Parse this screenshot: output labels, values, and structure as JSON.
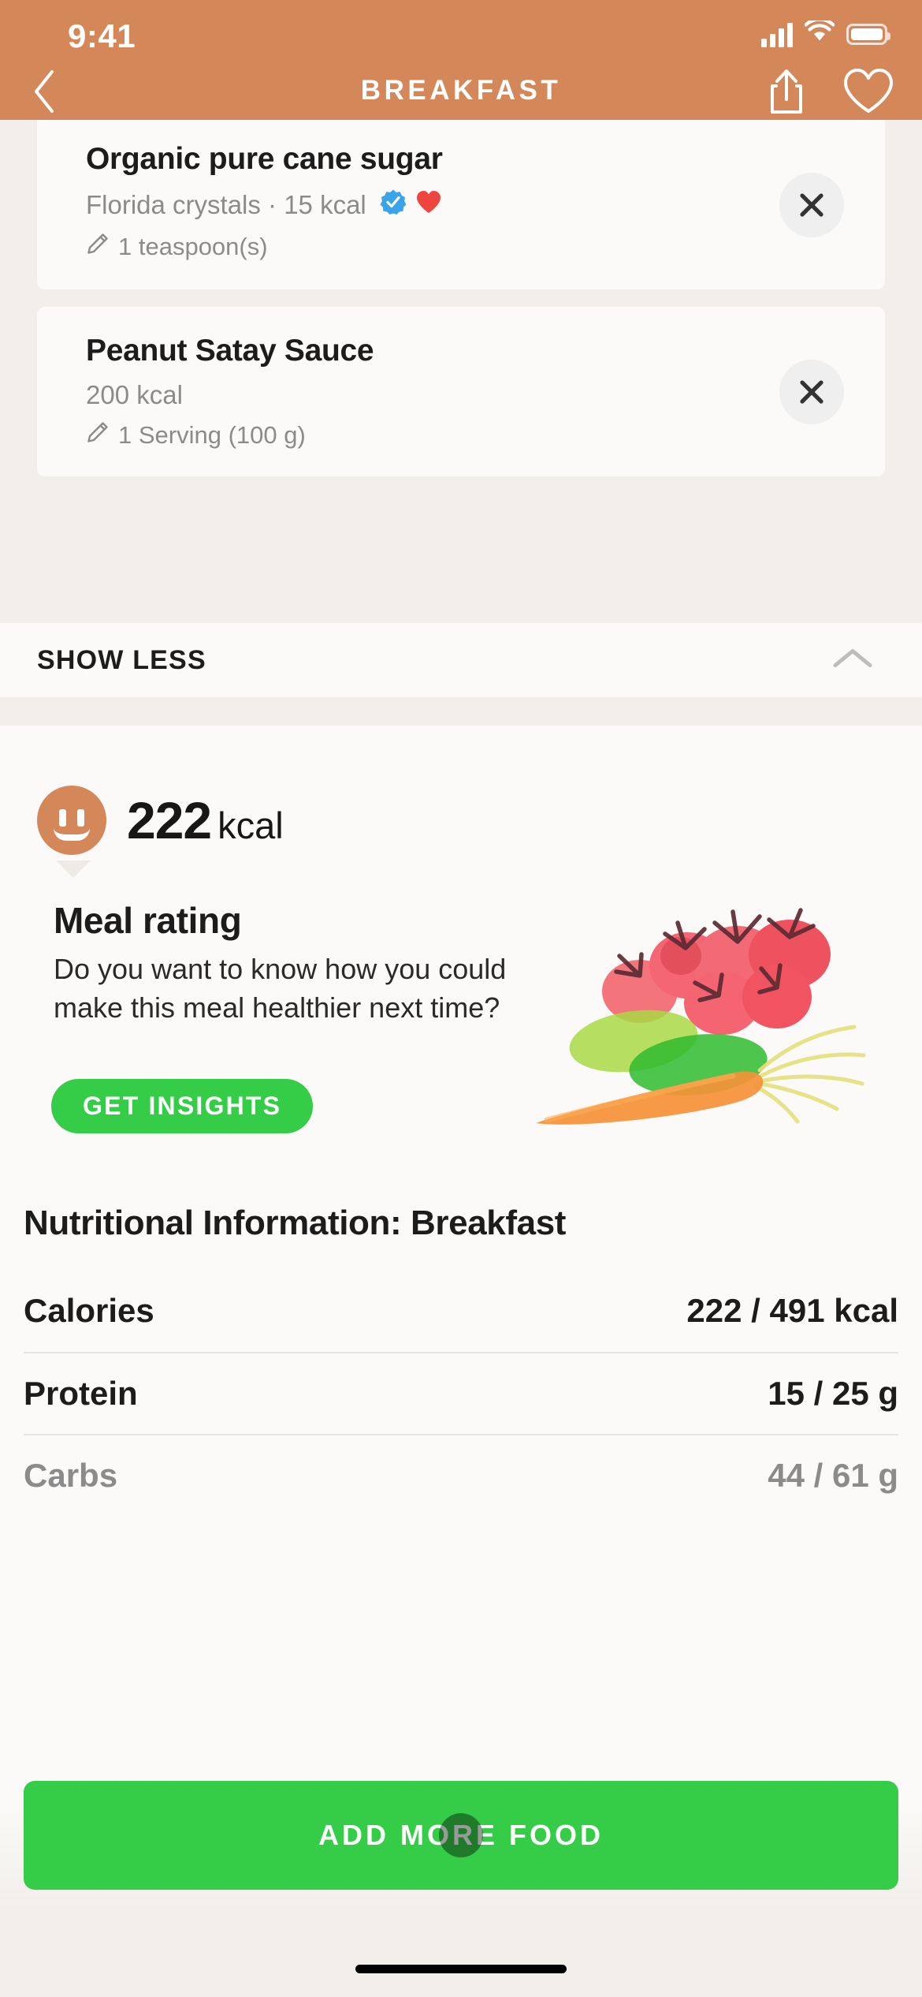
{
  "status_bar": {
    "time": "9:41",
    "signal_icon": "cellular-signal-icon",
    "wifi_icon": "wifi-icon",
    "battery_icon": "battery-icon"
  },
  "header": {
    "title": "BREAKFAST",
    "back_icon": "back-chevron-icon",
    "share_icon": "share-icon",
    "favorite_icon": "heart-outline-icon",
    "background_color": "#d4885a"
  },
  "food_items": [
    {
      "name": "Organic pure cane sugar",
      "subtitle": "Florida crystals · 15 kcal",
      "verified_badge": "verified-check-icon",
      "favorite_badge": "heart-filled-icon",
      "serving": "1 teaspoon(s)",
      "edit_icon": "pencil-icon",
      "remove_icon": "close-x-icon"
    },
    {
      "name": "Peanut Satay Sauce",
      "subtitle": "200 kcal",
      "verified_badge": null,
      "favorite_badge": null,
      "serving": "1 Serving (100 g)",
      "edit_icon": "pencil-icon",
      "remove_icon": "close-x-icon"
    }
  ],
  "show_less": {
    "label": "SHOW LESS",
    "chevron_icon": "chevron-up-icon"
  },
  "summary": {
    "calories_value": "222",
    "calories_unit": "kcal",
    "face_icon": "neutral-face-icon",
    "face_color": "#d4885a"
  },
  "meal_rating": {
    "title": "Meal rating",
    "description": "Do you want to know how you could make this meal healthier next time?",
    "button_label": "GET INSIGHTS",
    "button_color": "#35cc47",
    "illustration": "vegetables-watercolor-illustration"
  },
  "nutrition": {
    "title": "Nutritional Information: Breakfast",
    "rows": [
      {
        "label": "Calories",
        "value": "222 / 491 kcal"
      },
      {
        "label": "Protein",
        "value": "15 / 25 g"
      },
      {
        "label": "Carbs",
        "value": "44 / 61 g"
      }
    ]
  },
  "cta": {
    "label": "ADD MORE FOOD",
    "color": "#35cc47",
    "touch_indicator": "tap-indicator-dot"
  }
}
